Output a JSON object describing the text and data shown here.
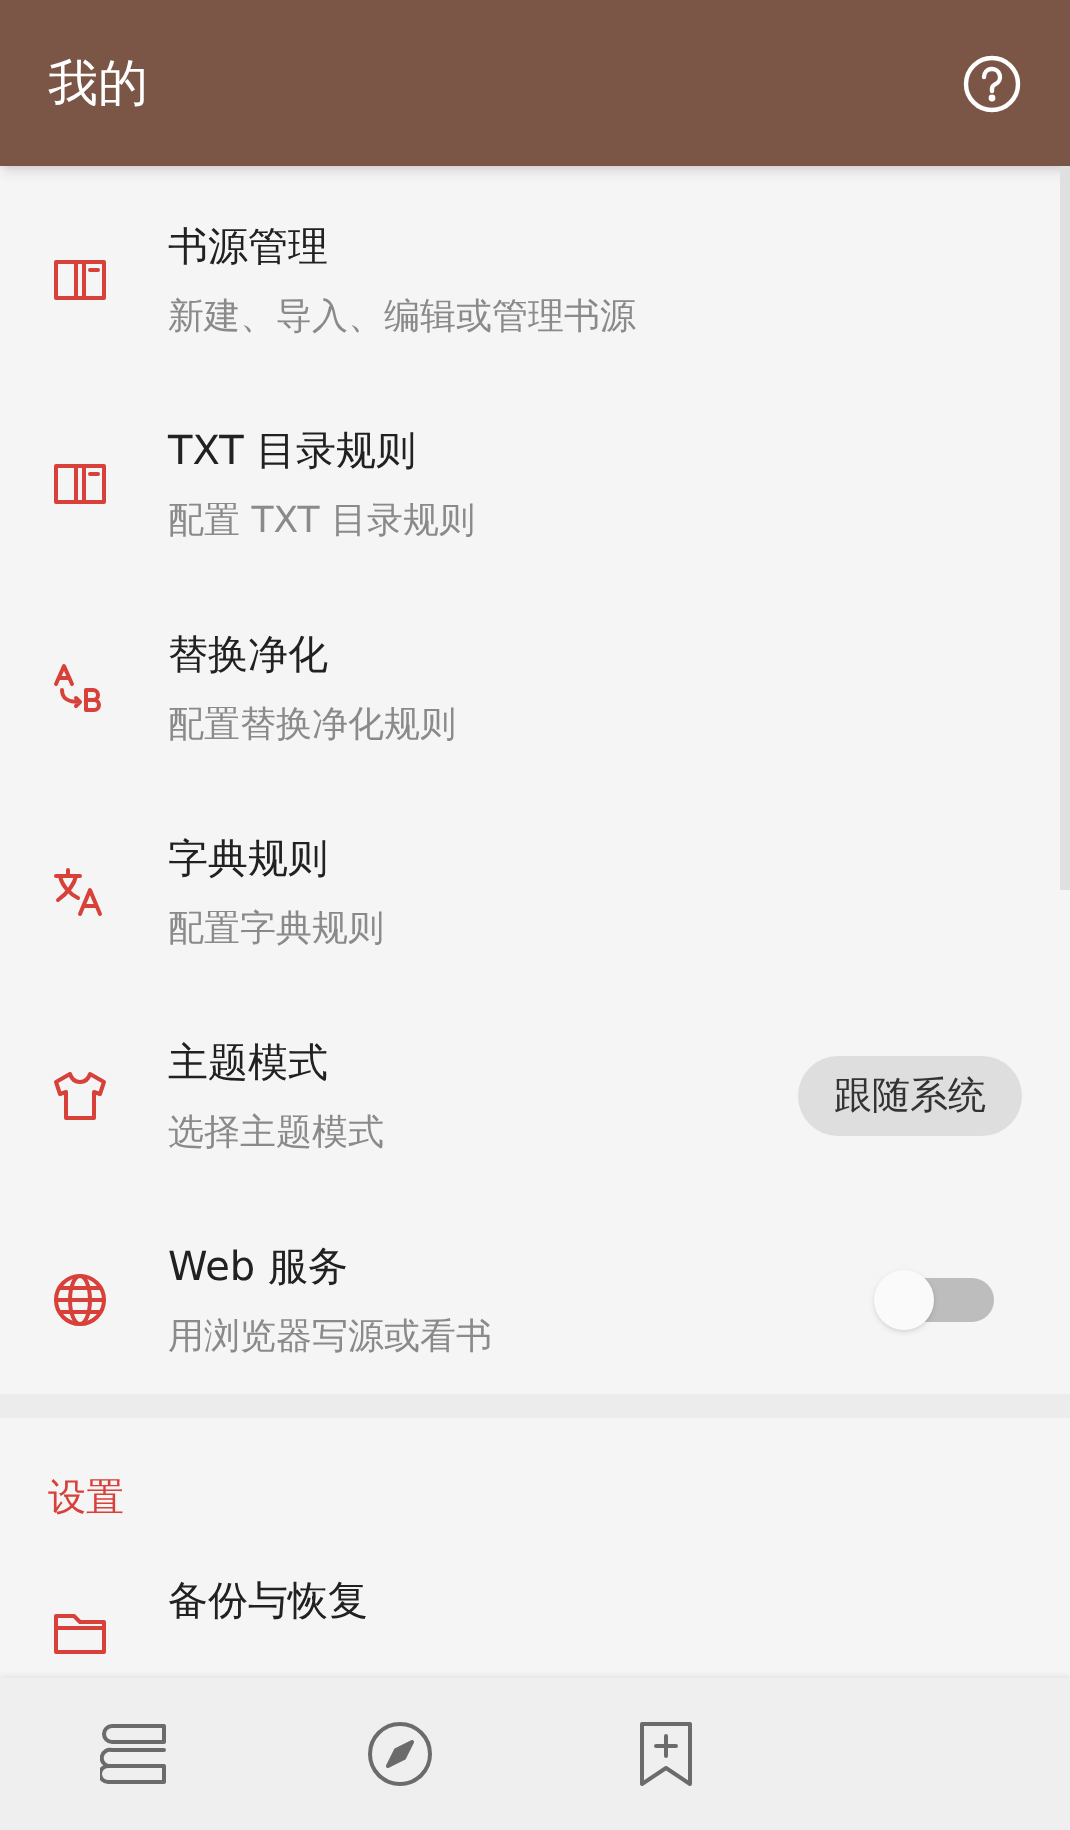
{
  "app_bar": {
    "title": "我的"
  },
  "items": [
    {
      "kind": "plain",
      "title": "书源管理",
      "subtitle": "新建、导入、编辑或管理书源"
    },
    {
      "kind": "plain",
      "title": "TXT 目录规则",
      "subtitle": "配置 TXT 目录规则"
    },
    {
      "kind": "plain",
      "title": "替换净化",
      "subtitle": "配置替换净化规则"
    },
    {
      "kind": "plain",
      "title": "字典规则",
      "subtitle": "配置字典规则"
    },
    {
      "kind": "select",
      "title": "主题模式",
      "subtitle": "选择主题模式",
      "value": "跟随系统"
    },
    {
      "kind": "switch",
      "title": "Web 服务",
      "subtitle": "用浏览器写源或看书",
      "on": false
    }
  ],
  "settings_section": {
    "title": "设置",
    "items": [
      {
        "title": "备份与恢复"
      }
    ]
  },
  "bottom_nav": [
    {
      "selected": false
    },
    {
      "selected": false
    },
    {
      "selected": false
    }
  ]
}
